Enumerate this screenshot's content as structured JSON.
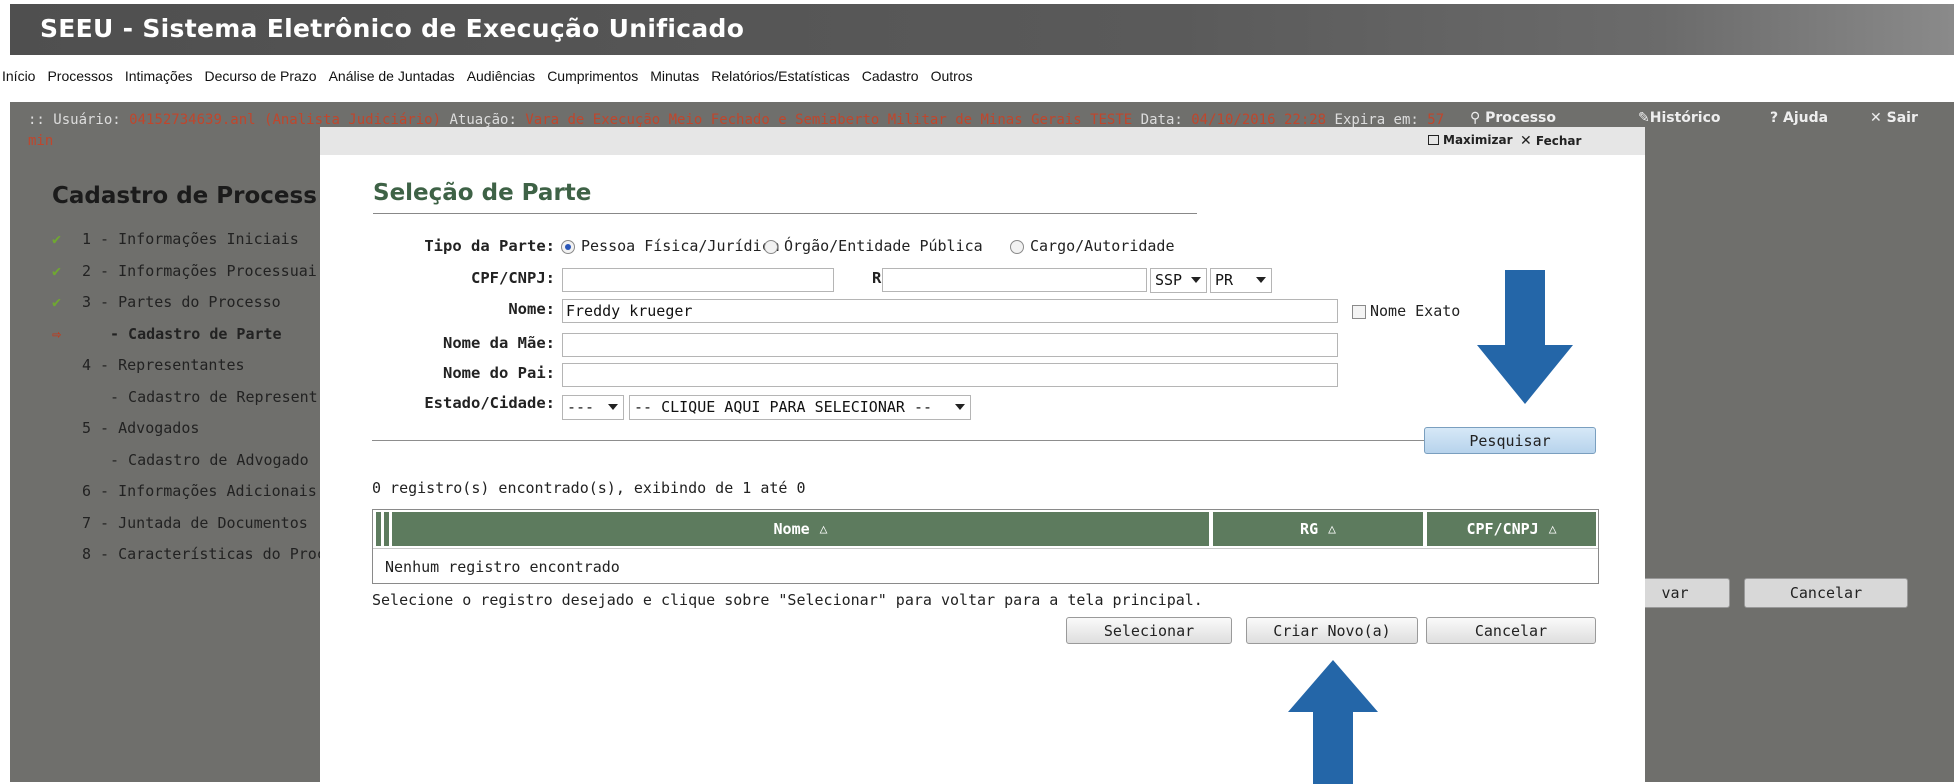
{
  "app": {
    "title": "SEEU - Sistema Eletrônico de Execução Unificado"
  },
  "menu": [
    "Início",
    "Processos",
    "Intimações",
    "Decurso de Prazo",
    "Análise de Juntadas",
    "Audiências",
    "Cumprimentos",
    "Minutas",
    "Relatórios/Estatísticas",
    "Cadastro",
    "Outros"
  ],
  "userbar": {
    "prefix": ":: Usuário:",
    "user": "04152734639.anl (Analista Judiciário)",
    "atuacao_label": "Atuação:",
    "atuacao": "Vara de Execução Meio Fechado e Semiaberto Militar de Minas Gerais TESTE",
    "data_label": "Data:",
    "data": "04/10/2016 22:28",
    "expira_label": "Expira em:",
    "expira": "57",
    "expira_unit": "min",
    "processo": "Processo",
    "historico": "Histórico",
    "ajuda": "Ajuda",
    "sair": "Sair"
  },
  "background": {
    "title": "Cadastro de Process",
    "steps": [
      {
        "mark": "check",
        "label": "1 - Informações Iniciais"
      },
      {
        "mark": "check",
        "label": "2 - Informações Processuai"
      },
      {
        "mark": "check",
        "label": "3 - Partes do Processo"
      },
      {
        "mark": "arrow",
        "label": "- Cadastro de Parte"
      },
      {
        "mark": "",
        "label": "4 - Representantes"
      },
      {
        "mark": "",
        "label": "- Cadastro de Represent"
      },
      {
        "mark": "",
        "label": "5 - Advogados"
      },
      {
        "mark": "",
        "label": "- Cadastro de Advogado"
      },
      {
        "mark": "",
        "label": "6 - Informações Adicionais"
      },
      {
        "mark": "",
        "label": "7 - Juntada de Documentos"
      },
      {
        "mark": "",
        "label": "8 - Características do Proce"
      }
    ],
    "btn_salvar_partial": "var",
    "btn_cancelar": "Cancelar"
  },
  "modal": {
    "maximizar": "Maximizar",
    "fechar": "Fechar",
    "title": "Seleção de Parte",
    "tipo_label": "Tipo da Parte:",
    "tipo_options": [
      "Pessoa Física/Jurídica",
      "Órgão/Entidade Pública",
      "Cargo/Autoridade"
    ],
    "tipo_selected": 0,
    "cpf_label": "CPF/CNPJ:",
    "cpf_value": "",
    "rg_label": "RG:",
    "rg_value": "",
    "rg_orgao": "SSP",
    "rg_uf": "PR",
    "nome_label": "Nome:",
    "nome_value": "Freddy krueger",
    "nome_exato_label": "Nome Exato",
    "mae_label": "Nome da Mãe:",
    "mae_value": "",
    "pai_label": "Nome do Pai:",
    "pai_value": "",
    "estado_label": "Estado/Cidade:",
    "estado_value": "---",
    "cidade_value": "-- CLIQUE AQUI PARA SELECIONAR --",
    "pesquisar": "Pesquisar",
    "result_count": "0 registro(s) encontrado(s), exibindo de 1 até 0",
    "columns": [
      "Nome",
      "RG",
      "CPF/CNPJ"
    ],
    "sort_icon": "△",
    "empty": "Nenhum registro encontrado",
    "hint": "Selecione o registro desejado e clique sobre \"Selecionar\" para voltar para a tela principal.",
    "btn_selecionar": "Selecionar",
    "btn_criar": "Criar Novo(a)",
    "btn_cancelar": "Cancelar"
  },
  "colors": {
    "header_green": "#5d7b5e",
    "title_green": "#3e6246",
    "annotation_arrow": "#2466a8",
    "highlight_red": "#c0462c"
  }
}
